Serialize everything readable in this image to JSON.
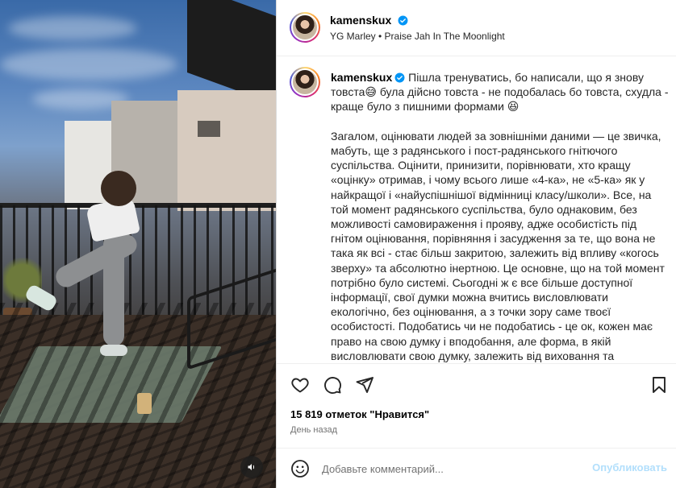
{
  "post": {
    "author": "kamenskux",
    "audio": "YG Marley • Praise Jah In The Moonlight",
    "caption_user": "kamenskux",
    "caption_body": " Пішла тренуватись, бо написали, що я знову товста😅 була дійсно товста - не подобалась бо товста, схудла - краще було з пишними формами 😆\n\nЗагалом, оцінювати людей за зовнішніми даними — це звичка, мабуть, ще з радянського і пост-радянського гнітючого суспільства. Оцінити, принизити, порівнювати, хто кращу «оцінку» отримав, і чому всього лише «4-ка», не «5-ка» як у найкращої і «найуспішнішої відмінниці класу/школи». Все, на той момент радянського суспільства, було однаковим, без можливості самовираження і прояву, адже особистість під гнітом оцінювання, порівняння і засудження за те, що вона не така як всі - стає більш закритою, залежить від впливу «когось зверху» та абсолютно інертною. Це основне, що на той момент потрібно було системі. Сьогодні ж є все більше доступної інформації, свої думки можна вчитись висловлювати екологічно, без оцінювання, а з точки зору саме твоєї особистості. Подобатись чи не подобатись - це ок, кожен має право на свою думку і вподобання, але форма, в якій висловлювати свою думку, залежить від виховання та",
    "likes": "15 819 отметок \"Нравится\"",
    "time": "День назад"
  },
  "comment": {
    "placeholder": "Добавьте комментарий...",
    "publish": "Опубликовать"
  },
  "icons": {
    "verified": "verified-badge-icon",
    "like": "heart-icon",
    "comment": "speech-bubble-icon",
    "share": "paper-plane-icon",
    "save": "bookmark-icon",
    "emoji": "smiley-icon",
    "sound": "speaker-icon"
  },
  "colors": {
    "verified": "#0095f6",
    "publish_disabled": "#b2dffc",
    "muted_text": "#737373"
  }
}
